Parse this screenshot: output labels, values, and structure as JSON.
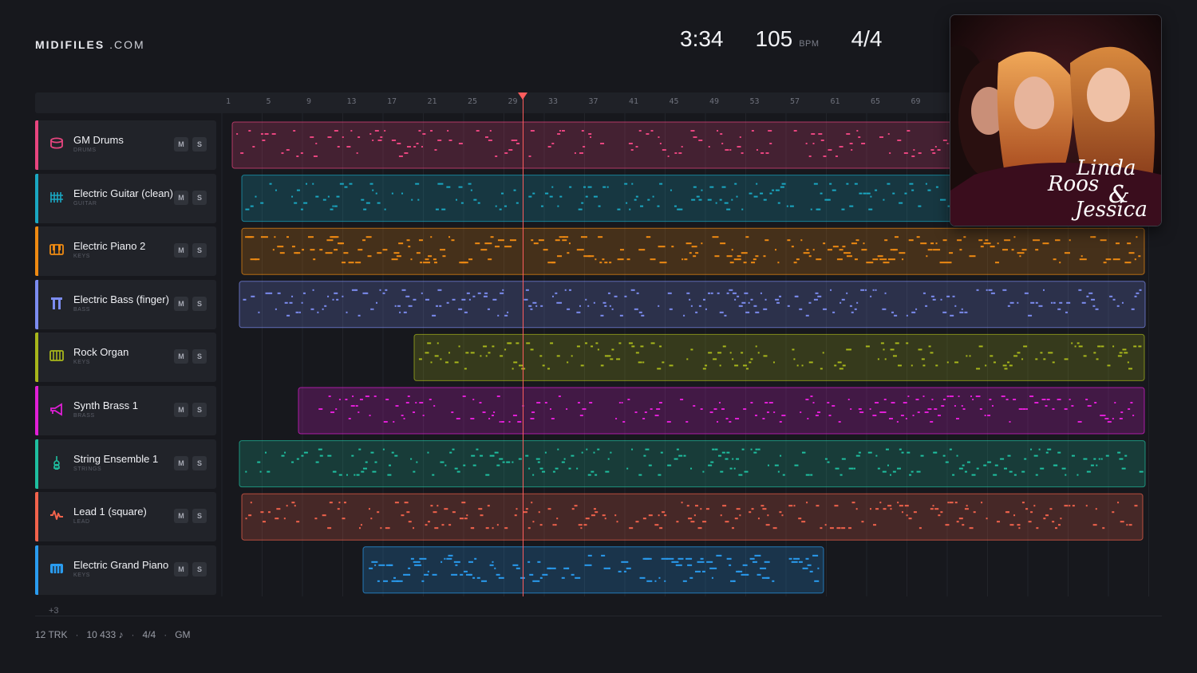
{
  "brand": {
    "name": "MIDIFILES",
    "domain": ".COM"
  },
  "header": {
    "time": "3:34",
    "bpm": "105",
    "bpm_unit": "BPM",
    "signature": "4/4"
  },
  "ruler": {
    "ticks": [
      "1",
      "5",
      "9",
      "13",
      "17",
      "21",
      "25",
      "29",
      "33",
      "37",
      "41",
      "45",
      "49",
      "53",
      "57",
      "61",
      "65",
      "69"
    ]
  },
  "tracks": [
    {
      "name": "GM Drums",
      "category": "DRUMS",
      "color": "#e8457f",
      "icon": "drum-icon",
      "mute": "M",
      "solo": "S"
    },
    {
      "name": "Electric Guitar (clean)",
      "category": "GUITAR",
      "color": "#1aa7c2",
      "icon": "guitar-icon",
      "mute": "M",
      "solo": "S"
    },
    {
      "name": "Electric Piano 2",
      "category": "KEYS",
      "color": "#ef8a12",
      "icon": "piano-icon",
      "mute": "M",
      "solo": "S"
    },
    {
      "name": "Electric Bass (finger)",
      "category": "BASS",
      "color": "#7c8cf0",
      "icon": "bass-icon",
      "mute": "M",
      "solo": "S"
    },
    {
      "name": "Rock Organ",
      "category": "KEYS",
      "color": "#a7b61b",
      "icon": "organ-icon",
      "mute": "M",
      "solo": "S"
    },
    {
      "name": "Synth Brass 1",
      "category": "BRASS",
      "color": "#e01fd6",
      "icon": "brass-icon",
      "mute": "M",
      "solo": "S"
    },
    {
      "name": "String Ensemble 1",
      "category": "STRINGS",
      "color": "#1fbfa0",
      "icon": "violin-icon",
      "mute": "M",
      "solo": "S"
    },
    {
      "name": "Lead 1 (square)",
      "category": "LEAD",
      "color": "#f2634c",
      "icon": "wave-icon",
      "mute": "M",
      "solo": "S"
    },
    {
      "name": "Electric Grand Piano",
      "category": "KEYS",
      "color": "#2a9cf0",
      "icon": "grand-piano-icon",
      "mute": "M",
      "solo": "S"
    }
  ],
  "more_tracks": "+3",
  "footer": {
    "tracks": "12 TRK",
    "notes": "10 433 ♪",
    "signature": "4/4",
    "standard": "GM"
  },
  "cover": {
    "title_lines": [
      "Linda",
      "Roos",
      "&",
      "Jessica"
    ]
  }
}
